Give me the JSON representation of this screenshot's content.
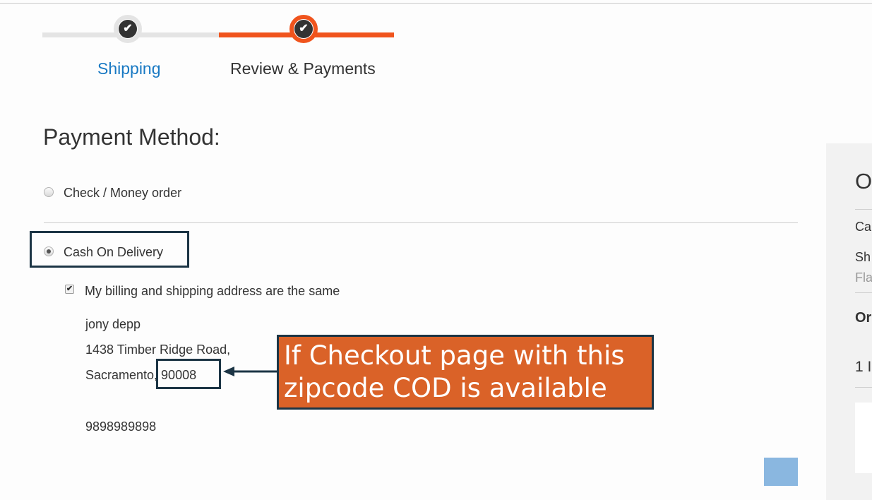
{
  "progress": {
    "steps": [
      {
        "label": "Shipping",
        "icon": "check-icon",
        "state": "complete"
      },
      {
        "label": "Review & Payments",
        "icon": "check-icon",
        "state": "active"
      }
    ],
    "check_glyph": "✔",
    "active_color": "#f0541d"
  },
  "payment": {
    "title": "Payment Method:",
    "options": [
      {
        "label": "Check / Money order",
        "selected": false
      },
      {
        "label": "Cash On Delivery",
        "selected": true
      }
    ],
    "same_address_label": "My billing and shipping address are the same",
    "check_mark": "✔"
  },
  "address": {
    "name": "jony depp",
    "street": "1438 Timber Ridge Road,",
    "city_zip": "Sacramento, 90008",
    "phone": "9898989898"
  },
  "annotation": {
    "line1": "If Checkout page with this",
    "line2": "zipcode COD is available",
    "color": "#da6228"
  },
  "summary_partial": {
    "title": "O",
    "line_ca": "Ca",
    "line_sh": "Sh",
    "line_fla": "Fla",
    "line_or": "Or",
    "line_1": "1 I"
  }
}
